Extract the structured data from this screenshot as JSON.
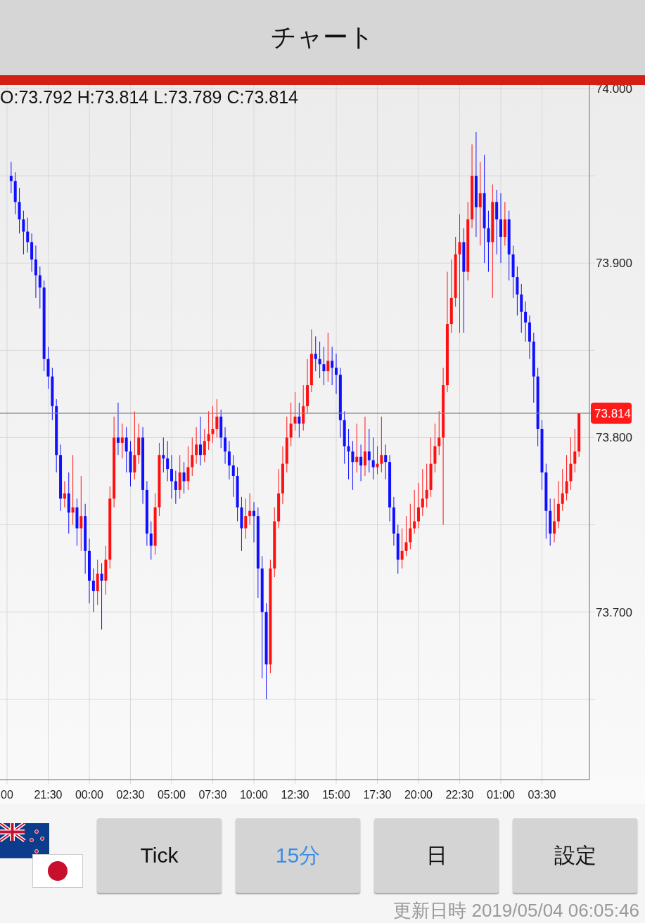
{
  "header": {
    "title": "チャート"
  },
  "chart": {
    "ohlc": "O:73.792 H:73.814 L:73.789 C:73.814",
    "chart_data": {
      "type": "candlestick",
      "ylim": [
        73.604,
        74.002
      ],
      "grid": true,
      "ref_lines": [
        {
          "axis": "y",
          "value": 73.814,
          "label": "73.814"
        }
      ],
      "yticks": [
        {
          "value": 74.0,
          "label": "74.000"
        },
        {
          "value": 73.9,
          "label": "73.900"
        },
        {
          "value": 73.8,
          "label": "73.800"
        },
        {
          "value": 73.7,
          "label": "73.700"
        }
      ],
      "categories": [
        "00",
        null,
        null,
        null,
        null,
        null,
        null,
        null,
        null,
        null,
        "21:30",
        null,
        null,
        null,
        null,
        null,
        null,
        null,
        null,
        null,
        "00:00",
        null,
        null,
        null,
        null,
        null,
        null,
        null,
        null,
        null,
        "02:30",
        null,
        null,
        null,
        null,
        null,
        null,
        null,
        null,
        null,
        "05:00",
        null,
        null,
        null,
        null,
        null,
        null,
        null,
        null,
        null,
        "07:30",
        null,
        null,
        null,
        null,
        null,
        null,
        null,
        null,
        null,
        "10:00",
        null,
        null,
        null,
        null,
        null,
        null,
        null,
        null,
        null,
        "12:30",
        null,
        null,
        null,
        null,
        null,
        null,
        null,
        null,
        null,
        "15:00",
        null,
        null,
        null,
        null,
        null,
        null,
        null,
        null,
        null,
        "17:30",
        null,
        null,
        null,
        null,
        null,
        null,
        null,
        null,
        null,
        "20:00",
        null,
        null,
        null,
        null,
        null,
        null,
        null,
        null,
        null,
        "22:30",
        null,
        null,
        null,
        null,
        null,
        null,
        null,
        null,
        null,
        "01:00",
        null,
        null,
        null,
        null,
        null,
        null,
        null,
        null,
        null,
        "03:30",
        null,
        null,
        null,
        null,
        null,
        null,
        null,
        null,
        null
      ],
      "ohlc": [
        null,
        [
          73.95,
          73.958,
          73.94,
          73.947
        ],
        [
          73.947,
          73.952,
          73.928,
          73.935
        ],
        [
          73.935,
          73.943,
          73.917,
          73.925
        ],
        [
          73.925,
          73.93,
          73.905,
          73.918
        ],
        [
          73.918,
          73.926,
          73.906,
          73.912
        ],
        [
          73.912,
          73.917,
          73.895,
          73.902
        ],
        [
          73.902,
          73.91,
          73.88,
          73.893
        ],
        [
          73.893,
          73.898,
          73.874,
          73.886
        ],
        [
          73.886,
          73.89,
          73.838,
          73.845
        ],
        [
          73.845,
          73.852,
          73.828,
          73.835
        ],
        [
          73.835,
          73.84,
          73.81,
          73.818
        ],
        [
          73.818,
          73.822,
          73.78,
          73.79
        ],
        [
          73.79,
          73.796,
          73.758,
          73.765
        ],
        [
          73.765,
          73.775,
          73.76,
          73.768
        ],
        [
          73.768,
          73.78,
          73.745,
          73.757
        ],
        [
          73.757,
          73.79,
          73.75,
          73.76
        ],
        [
          73.76,
          73.765,
          73.738,
          73.748
        ],
        [
          73.748,
          73.778,
          73.735,
          73.755
        ],
        [
          73.755,
          73.762,
          73.722,
          73.735
        ],
        [
          73.735,
          73.742,
          73.705,
          73.718
        ],
        [
          73.718,
          73.725,
          73.7,
          73.712
        ],
        [
          73.712,
          73.73,
          73.704,
          73.722
        ],
        [
          73.722,
          73.728,
          73.69,
          73.718
        ],
        [
          73.718,
          73.738,
          73.71,
          73.73
        ],
        [
          73.73,
          73.772,
          73.725,
          73.765
        ],
        [
          73.765,
          73.812,
          73.76,
          73.8
        ],
        [
          73.8,
          73.82,
          73.79,
          73.797
        ],
        [
          73.797,
          73.808,
          73.788,
          73.8
        ],
        [
          73.8,
          73.806,
          73.78,
          73.792
        ],
        [
          73.792,
          73.798,
          73.772,
          73.78
        ],
        [
          73.78,
          73.815,
          73.776,
          73.79
        ],
        [
          73.79,
          73.808,
          73.785,
          73.8
        ],
        [
          73.8,
          73.806,
          73.762,
          73.77
        ],
        [
          73.77,
          73.775,
          73.738,
          73.745
        ],
        [
          73.745,
          73.752,
          73.73,
          73.738
        ],
        [
          73.738,
          73.768,
          73.733,
          73.76
        ],
        [
          73.76,
          73.797,
          73.755,
          73.79
        ],
        [
          73.79,
          73.8,
          73.78,
          73.788
        ],
        [
          73.788,
          73.798,
          73.775,
          73.782
        ],
        [
          73.782,
          73.79,
          73.765,
          73.775
        ],
        [
          73.775,
          73.781,
          73.762,
          73.77
        ],
        [
          73.77,
          73.79,
          73.765,
          73.78
        ],
        [
          73.78,
          73.786,
          73.768,
          73.775
        ],
        [
          73.775,
          73.795,
          73.77,
          73.783
        ],
        [
          73.783,
          73.8,
          73.778,
          73.79
        ],
        [
          73.79,
          73.806,
          73.785,
          73.796
        ],
        [
          73.796,
          73.812,
          73.784,
          73.79
        ],
        [
          73.79,
          73.805,
          73.786,
          73.798
        ],
        [
          73.798,
          73.815,
          73.793,
          73.802
        ],
        [
          73.802,
          73.818,
          73.797,
          73.805
        ],
        [
          73.805,
          73.822,
          73.8,
          73.812
        ],
        [
          73.812,
          73.816,
          73.794,
          73.8
        ],
        [
          73.8,
          73.806,
          73.785,
          73.792
        ],
        [
          73.792,
          73.798,
          73.776,
          73.784
        ],
        [
          73.784,
          73.79,
          73.766,
          73.778
        ],
        [
          73.778,
          73.783,
          73.752,
          73.76
        ],
        [
          73.76,
          73.766,
          73.735,
          73.748
        ],
        [
          73.748,
          73.765,
          73.742,
          73.755
        ],
        [
          73.755,
          73.768,
          73.75,
          73.758
        ],
        [
          73.758,
          73.763,
          73.74,
          73.755
        ],
        [
          73.755,
          73.76,
          73.708,
          73.725
        ],
        [
          73.725,
          73.732,
          73.662,
          73.7
        ],
        [
          73.7,
          73.705,
          73.65,
          73.67
        ],
        [
          73.67,
          73.73,
          73.665,
          73.725
        ],
        [
          73.725,
          73.76,
          73.72,
          73.752
        ],
        [
          73.752,
          73.782,
          73.748,
          73.768
        ],
        [
          73.768,
          73.795,
          73.762,
          73.785
        ],
        [
          73.785,
          73.812,
          73.78,
          73.8
        ],
        [
          73.8,
          73.82,
          73.795,
          73.808
        ],
        [
          73.808,
          73.826,
          73.804,
          73.812
        ],
        [
          73.812,
          73.82,
          73.8,
          73.808
        ],
        [
          73.808,
          73.83,
          73.804,
          73.818
        ],
        [
          73.818,
          73.845,
          73.814,
          73.83
        ],
        [
          73.83,
          73.862,
          73.826,
          73.848
        ],
        [
          73.848,
          73.858,
          73.838,
          73.845
        ],
        [
          73.845,
          73.855,
          73.834,
          73.842
        ],
        [
          73.842,
          73.852,
          73.83,
          73.838
        ],
        [
          73.838,
          73.86,
          73.832,
          73.844
        ],
        [
          73.844,
          73.852,
          73.83,
          73.84
        ],
        [
          73.84,
          73.848,
          73.825,
          73.836
        ],
        [
          73.836,
          73.84,
          73.8,
          73.81
        ],
        [
          73.81,
          73.815,
          73.785,
          73.795
        ],
        [
          73.795,
          73.805,
          73.776,
          73.792
        ],
        [
          73.792,
          73.798,
          73.77,
          73.786
        ],
        [
          73.786,
          73.808,
          73.78,
          73.789
        ],
        [
          73.789,
          73.796,
          73.775,
          73.784
        ],
        [
          73.784,
          73.812,
          73.778,
          73.792
        ],
        [
          73.792,
          73.805,
          73.78,
          73.787
        ],
        [
          73.787,
          73.8,
          73.776,
          73.783
        ],
        [
          73.783,
          73.795,
          73.779,
          73.785
        ],
        [
          73.785,
          73.812,
          73.78,
          73.79
        ],
        [
          73.79,
          73.796,
          73.776,
          73.786
        ],
        [
          73.786,
          73.79,
          73.752,
          73.76
        ],
        [
          73.76,
          73.766,
          73.738,
          73.745
        ],
        [
          73.745,
          73.75,
          73.722,
          73.73
        ],
        [
          73.73,
          73.748,
          73.725,
          73.735
        ],
        [
          73.735,
          73.755,
          73.732,
          73.74
        ],
        [
          73.74,
          73.762,
          73.736,
          73.748
        ],
        [
          73.748,
          73.77,
          73.745,
          73.752
        ],
        [
          73.752,
          73.774,
          73.748,
          73.76
        ],
        [
          73.76,
          73.782,
          73.755,
          73.765
        ],
        [
          73.765,
          73.785,
          73.76,
          73.77
        ],
        [
          73.77,
          73.8,
          73.766,
          73.785
        ],
        [
          73.785,
          73.808,
          73.78,
          73.795
        ],
        [
          73.795,
          73.815,
          73.79,
          73.8
        ],
        [
          73.8,
          73.84,
          73.75,
          73.83
        ],
        [
          73.83,
          73.895,
          73.826,
          73.865
        ],
        [
          73.865,
          73.902,
          73.86,
          73.88
        ],
        [
          73.88,
          73.915,
          73.875,
          73.905
        ],
        [
          73.905,
          73.928,
          73.86,
          73.912
        ],
        [
          73.912,
          73.92,
          73.86,
          73.895
        ],
        [
          73.895,
          73.935,
          73.89,
          73.925
        ],
        [
          73.925,
          73.968,
          73.92,
          73.95
        ],
        [
          73.95,
          73.975,
          73.915,
          73.932
        ],
        [
          73.932,
          73.958,
          73.91,
          73.94
        ],
        [
          73.94,
          73.962,
          73.9,
          73.92
        ],
        [
          73.92,
          73.93,
          73.895,
          73.912
        ],
        [
          73.912,
          73.945,
          73.88,
          73.935
        ],
        [
          73.935,
          73.942,
          73.905,
          73.925
        ],
        [
          73.925,
          73.94,
          73.9,
          73.915
        ],
        [
          73.915,
          73.935,
          73.91,
          73.925
        ],
        [
          73.925,
          73.93,
          73.89,
          73.905
        ],
        [
          73.905,
          73.91,
          73.88,
          73.892
        ],
        [
          73.892,
          73.898,
          73.87,
          73.882
        ],
        [
          73.882,
          73.888,
          73.86,
          73.872
        ],
        [
          73.872,
          73.878,
          73.855,
          73.866
        ],
        [
          73.866,
          73.87,
          73.845,
          73.855
        ],
        [
          73.855,
          73.86,
          73.82,
          73.835
        ],
        [
          73.835,
          73.84,
          73.795,
          73.805
        ],
        [
          73.805,
          73.81,
          73.77,
          73.78
        ],
        [
          73.78,
          73.785,
          73.742,
          73.758
        ],
        [
          73.758,
          73.765,
          73.738,
          73.745
        ],
        [
          73.745,
          73.765,
          73.74,
          73.752
        ],
        [
          73.752,
          73.775,
          73.748,
          73.762
        ],
        [
          73.762,
          73.782,
          73.758,
          73.768
        ],
        [
          73.768,
          73.79,
          73.764,
          73.775
        ],
        [
          73.775,
          73.8,
          73.77,
          73.785
        ],
        [
          73.785,
          73.805,
          73.78,
          73.792
        ],
        [
          73.792,
          73.814,
          73.789,
          73.814
        ]
      ]
    }
  },
  "buttons": [
    {
      "label": "Tick",
      "selected": false
    },
    {
      "label": "15分",
      "selected": true
    },
    {
      "label": "日",
      "selected": false
    },
    {
      "label": "設定",
      "selected": false
    }
  ],
  "updated": "更新日時 2019/05/04 06:05:46"
}
